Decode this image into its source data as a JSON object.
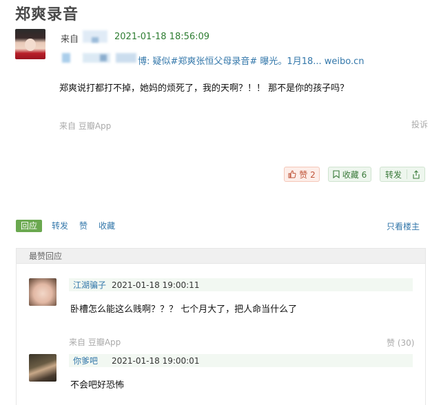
{
  "page_title": "郑爽录音",
  "post": {
    "from_label": "来自",
    "timestamp": "2021-01-18 18:56:09",
    "share_link": "博: 疑似#郑爽张恒父母录音# 曝光。1月18... weibo.cn",
    "body": "郑爽说打都打不掉，她妈的烦死了，我的天啊？！！ 那不是你的孩子吗？",
    "source": "来自 豆瓣App",
    "report": "投诉"
  },
  "actions": {
    "like_label": "赞 2",
    "collect_label": "收藏 6",
    "share_label": "转发"
  },
  "tabs": [
    "回应",
    "转发",
    "赞",
    "收藏"
  ],
  "only_op": "只看楼主",
  "comments_header": "最赞回应",
  "comments": [
    {
      "user": "江湖骗子",
      "time": "2021-01-18 19:00:11",
      "body": "卧槽怎么能这么贱啊？？？ 七个月大了，把人命当什么了",
      "source": "来自 豆瓣App",
      "votes": "赞 (30)"
    },
    {
      "user": "你爹吧",
      "time": "2021-01-18 19:00:01",
      "body": "不会吧好恐怖"
    }
  ]
}
